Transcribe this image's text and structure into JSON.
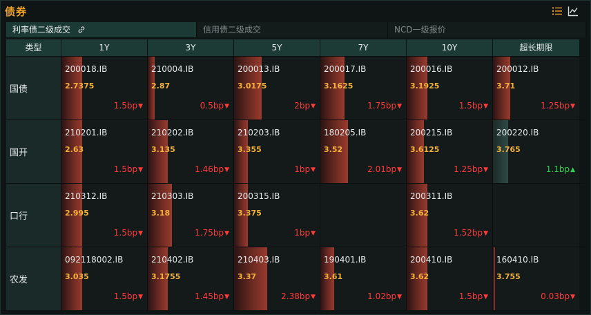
{
  "title": "债券",
  "tabs": [
    {
      "label": "利率债二级成交",
      "active": true
    },
    {
      "label": "信用债二级成交",
      "active": false
    },
    {
      "label": "NCD一级报价",
      "active": false
    }
  ],
  "icons": {
    "list": "list-icon",
    "chart": "line-chart-icon",
    "link": "link-icon"
  },
  "colors": {
    "title": "#f0a12a",
    "yield": "#f5b23a",
    "down": "#ff3b3b",
    "up": "#33d052",
    "header_bg": "#1c3b37"
  },
  "columns": [
    "类型",
    "1Y",
    "3Y",
    "5Y",
    "7Y",
    "10Y",
    "超长期限"
  ],
  "rows": [
    {
      "type": "国债",
      "cells": [
        {
          "code": "200018.IB",
          "yield": "2.7375",
          "change": "1.5bp",
          "direction": "down",
          "intensity": 0.3
        },
        {
          "code": "210004.IB",
          "yield": "2.87",
          "change": "0.5bp",
          "direction": "down",
          "intensity": 0.1
        },
        {
          "code": "200013.IB",
          "yield": "3.0175",
          "change": "2bp",
          "direction": "down",
          "intensity": 0.4
        },
        {
          "code": "200017.IB",
          "yield": "3.1625",
          "change": "1.75bp",
          "direction": "down",
          "intensity": 0.35
        },
        {
          "code": "200016.IB",
          "yield": "3.1925",
          "change": "1.5bp",
          "direction": "down",
          "intensity": 0.3
        },
        {
          "code": "200012.IB",
          "yield": "3.71",
          "change": "1.25bp",
          "direction": "down",
          "intensity": 0.25
        }
      ]
    },
    {
      "type": "国开",
      "cells": [
        {
          "code": "210201.IB",
          "yield": "2.63",
          "change": "1.5bp",
          "direction": "down",
          "intensity": 0.3
        },
        {
          "code": "210202.IB",
          "yield": "3.135",
          "change": "1.46bp",
          "direction": "down",
          "intensity": 0.29
        },
        {
          "code": "210203.IB",
          "yield": "3.355",
          "change": "1bp",
          "direction": "down",
          "intensity": 0.2
        },
        {
          "code": "180205.IB",
          "yield": "3.52",
          "change": "2.01bp",
          "direction": "down",
          "intensity": 0.4
        },
        {
          "code": "200215.IB",
          "yield": "3.6125",
          "change": "1.25bp",
          "direction": "down",
          "intensity": 0.25
        },
        {
          "code": "200220.IB",
          "yield": "3.765",
          "change": "1.1bp",
          "direction": "up",
          "intensity": 0.22
        }
      ]
    },
    {
      "type": "口行",
      "cells": [
        {
          "code": "210312.IB",
          "yield": "2.995",
          "change": "1.5bp",
          "direction": "down",
          "intensity": 0.3
        },
        {
          "code": "210303.IB",
          "yield": "3.18",
          "change": "1.75bp",
          "direction": "down",
          "intensity": 0.35
        },
        {
          "code": "200315.IB",
          "yield": "3.375",
          "change": "1bp",
          "direction": "down",
          "intensity": 0.2
        },
        null,
        {
          "code": "200311.IB",
          "yield": "3.62",
          "change": "1.52bp",
          "direction": "down",
          "intensity": 0.3
        },
        null
      ]
    },
    {
      "type": "农发",
      "cells": [
        {
          "code": "092118002.IB",
          "yield": "3.035",
          "change": "1.5bp",
          "direction": "down",
          "intensity": 0.3
        },
        {
          "code": "210402.IB",
          "yield": "3.1755",
          "change": "1.45bp",
          "direction": "down",
          "intensity": 0.29
        },
        {
          "code": "210403.IB",
          "yield": "3.37",
          "change": "2.38bp",
          "direction": "down",
          "intensity": 0.48
        },
        {
          "code": "190401.IB",
          "yield": "3.61",
          "change": "1.02bp",
          "direction": "down",
          "intensity": 0.2
        },
        {
          "code": "200410.IB",
          "yield": "3.62",
          "change": "1.5bp",
          "direction": "down",
          "intensity": 0.3
        },
        {
          "code": "160410.IB",
          "yield": "3.755",
          "change": "0.03bp",
          "direction": "down",
          "intensity": 0.02
        }
      ]
    }
  ]
}
